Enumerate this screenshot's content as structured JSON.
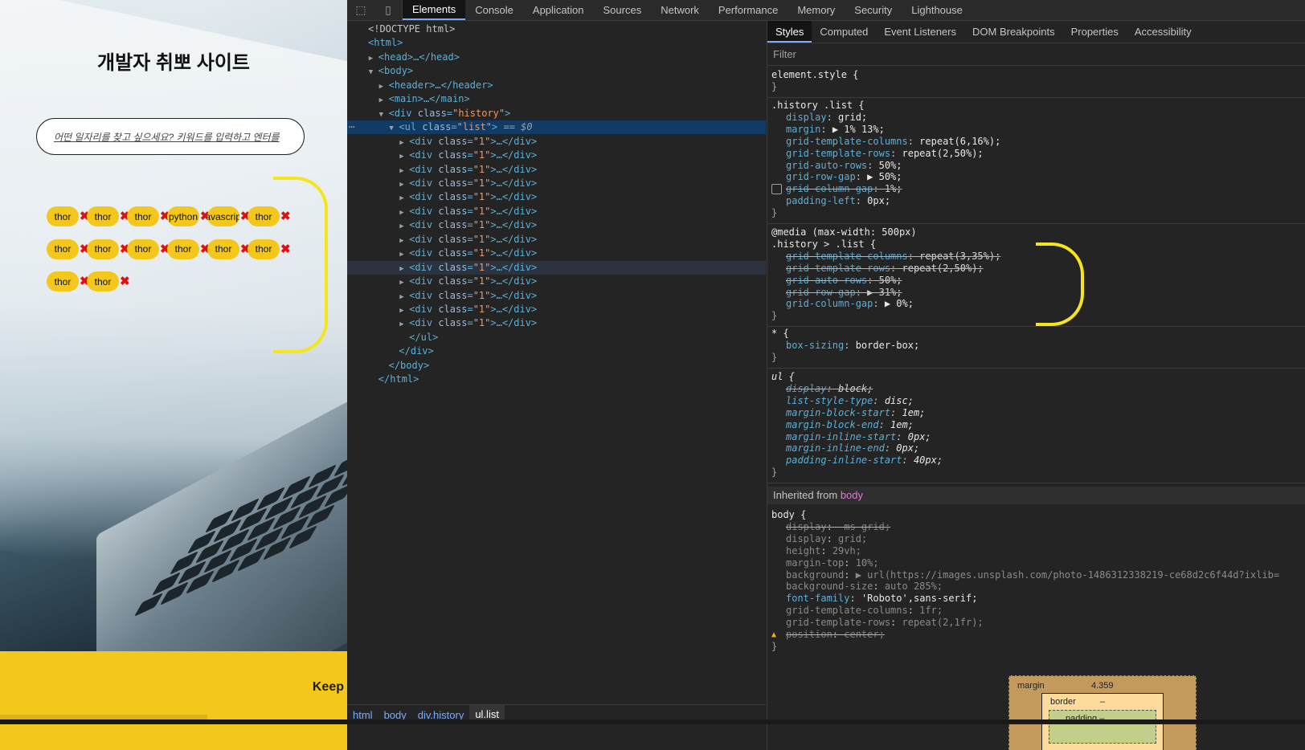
{
  "webpage": {
    "title": "개발자 취뽀 사이트",
    "search_placeholder": "어떤 일자리를 찾고 싶으세요? 키워드를 입력하고 엔터를",
    "tags": [
      "thor",
      "thor",
      "thor",
      "python",
      "javascript",
      "thor",
      "thor",
      "thor",
      "thor",
      "thor",
      "thor",
      "thor",
      "thor",
      "thor"
    ],
    "remove_glyph": "✖",
    "footer_text": "Keep"
  },
  "devtools": {
    "tabs": [
      "Elements",
      "Console",
      "Application",
      "Sources",
      "Network",
      "Performance",
      "Memory",
      "Security",
      "Lighthouse"
    ],
    "active_tab": "Elements",
    "dom": [
      {
        "indent": 0,
        "tri": "",
        "html": "&lt;!DOCTYPE html&gt;"
      },
      {
        "indent": 0,
        "tri": "",
        "tag": "<html>"
      },
      {
        "indent": 1,
        "tri": "▶",
        "tag": "<head>…</head>"
      },
      {
        "indent": 1,
        "tri": "▼",
        "tag": "<body>"
      },
      {
        "indent": 2,
        "tri": "▶",
        "tag": "<header>…</header>"
      },
      {
        "indent": 2,
        "tri": "▶",
        "tag": "<main>…</main>"
      },
      {
        "indent": 2,
        "tri": "▼",
        "tag": "<div",
        "attr": "class",
        "val": "\"history\"",
        "close": ">"
      },
      {
        "indent": 3,
        "tri": "▼",
        "tag": "<ul",
        "attr": "class",
        "val": "\"list\"",
        "close": ">",
        "suffix": " == $0",
        "selected": true
      },
      {
        "indent": 4,
        "tri": "▶",
        "tag": "<div",
        "attr": "class",
        "val": "\"1\"",
        "close": ">…</div>"
      },
      {
        "indent": 4,
        "tri": "▶",
        "tag": "<div",
        "attr": "class",
        "val": "\"1\"",
        "close": ">…</div>"
      },
      {
        "indent": 4,
        "tri": "▶",
        "tag": "<div",
        "attr": "class",
        "val": "\"1\"",
        "close": ">…</div>"
      },
      {
        "indent": 4,
        "tri": "▶",
        "tag": "<div",
        "attr": "class",
        "val": "\"1\"",
        "close": ">…</div>"
      },
      {
        "indent": 4,
        "tri": "▶",
        "tag": "<div",
        "attr": "class",
        "val": "\"1\"",
        "close": ">…</div>"
      },
      {
        "indent": 4,
        "tri": "▶",
        "tag": "<div",
        "attr": "class",
        "val": "\"1\"",
        "close": ">…</div>"
      },
      {
        "indent": 4,
        "tri": "▶",
        "tag": "<div",
        "attr": "class",
        "val": "\"1\"",
        "close": ">…</div>"
      },
      {
        "indent": 4,
        "tri": "▶",
        "tag": "<div",
        "attr": "class",
        "val": "\"1\"",
        "close": ">…</div>"
      },
      {
        "indent": 4,
        "tri": "▶",
        "tag": "<div",
        "attr": "class",
        "val": "\"1\"",
        "close": ">…</div>"
      },
      {
        "indent": 4,
        "tri": "▶",
        "tag": "<div",
        "attr": "class",
        "val": "\"1\"",
        "close": ">…</div>",
        "hover": true
      },
      {
        "indent": 4,
        "tri": "▶",
        "tag": "<div",
        "attr": "class",
        "val": "\"1\"",
        "close": ">…</div>"
      },
      {
        "indent": 4,
        "tri": "▶",
        "tag": "<div",
        "attr": "class",
        "val": "\"1\"",
        "close": ">…</div>"
      },
      {
        "indent": 4,
        "tri": "▶",
        "tag": "<div",
        "attr": "class",
        "val": "\"1\"",
        "close": ">…</div>"
      },
      {
        "indent": 4,
        "tri": "▶",
        "tag": "<div",
        "attr": "class",
        "val": "\"1\"",
        "close": ">…</div>"
      },
      {
        "indent": 4,
        "tri": "",
        "tag": "</ul>"
      },
      {
        "indent": 3,
        "tri": "",
        "tag": "</div>"
      },
      {
        "indent": 2,
        "tri": "",
        "tag": "</body>"
      },
      {
        "indent": 1,
        "tri": "",
        "tag": "</html>"
      }
    ],
    "breadcrumbs": [
      "html",
      "body",
      "div.history",
      "ul.list"
    ],
    "styles_tabs": [
      "Styles",
      "Computed",
      "Event Listeners",
      "DOM Breakpoints",
      "Properties",
      "Accessibility"
    ],
    "filter_placeholder": "Filter",
    "rules": [
      {
        "lines": [
          {
            "t": "sel",
            "text": "element.style {"
          },
          {
            "t": "close",
            "text": "}"
          }
        ]
      },
      {
        "lines": [
          {
            "t": "sel",
            "text": ".history .list {"
          },
          {
            "t": "p",
            "n": "display",
            "v": "grid;"
          },
          {
            "t": "p",
            "n": "margin",
            "v": "▶ 1% 13%;"
          },
          {
            "t": "p",
            "n": "grid-template-columns",
            "v": "repeat(6,16%);"
          },
          {
            "t": "p",
            "n": "grid-template-rows",
            "v": "repeat(2,50%);"
          },
          {
            "t": "p",
            "n": "grid-auto-rows",
            "v": "50%;"
          },
          {
            "t": "p",
            "n": "grid-row-gap",
            "v": "▶ 50%;"
          },
          {
            "t": "p",
            "n": "grid-column-gap",
            "v": "1%;",
            "struck": true,
            "checkbox": true
          },
          {
            "t": "p",
            "n": "padding-left",
            "v": "0px;"
          },
          {
            "t": "close",
            "text": "}"
          }
        ]
      },
      {
        "lines": [
          {
            "t": "sel",
            "text": "@media (max-width: 500px)"
          },
          {
            "t": "sel",
            "text": ".history > .list {"
          },
          {
            "t": "p",
            "n": "grid-template-columns",
            "v": "repeat(3,35%);",
            "struck": true
          },
          {
            "t": "p",
            "n": "grid-template-rows",
            "v": "repeat(2,50%);",
            "struck": true
          },
          {
            "t": "p",
            "n": "grid-auto-rows",
            "v": "50%;",
            "struck": true
          },
          {
            "t": "p",
            "n": "grid-row-gap",
            "v": "▶ 31%;",
            "struck": true
          },
          {
            "t": "p",
            "n": "grid-column-gap",
            "v": "▶ 0%;"
          },
          {
            "t": "close",
            "text": "}"
          }
        ]
      },
      {
        "lines": [
          {
            "t": "sel",
            "text": "* {"
          },
          {
            "t": "p",
            "n": "box-sizing",
            "v": "border-box;"
          },
          {
            "t": "close",
            "text": "}"
          }
        ]
      },
      {
        "lines": [
          {
            "t": "sel",
            "text": "ul {",
            "ital": true
          },
          {
            "t": "p",
            "n": "display",
            "v": "block;",
            "struck": true,
            "ital": true
          },
          {
            "t": "p",
            "n": "list-style-type",
            "v": "disc;",
            "ital": true
          },
          {
            "t": "p",
            "n": "margin-block-start",
            "v": "1em;",
            "ital": true
          },
          {
            "t": "p",
            "n": "margin-block-end",
            "v": "1em;",
            "ital": true
          },
          {
            "t": "p",
            "n": "margin-inline-start",
            "v": "0px;",
            "ital": true
          },
          {
            "t": "p",
            "n": "margin-inline-end",
            "v": "0px;",
            "ital": true
          },
          {
            "t": "p",
            "n": "padding-inline-start",
            "v": "40px;",
            "ital": true
          },
          {
            "t": "close",
            "text": "}"
          }
        ]
      }
    ],
    "inherited_label": "Inherited from",
    "inherited_from": "body",
    "body_rule": [
      {
        "t": "sel",
        "text": "body {"
      },
      {
        "t": "p",
        "n": "-ms-display",
        "v": "-ms-grid;",
        "struck": true,
        "dim": true,
        "raw": "display: -ms-grid;"
      },
      {
        "t": "p",
        "n": "display",
        "v": "grid;",
        "dim": true
      },
      {
        "t": "p",
        "n": "height",
        "v": "29vh;",
        "dim": true
      },
      {
        "t": "p",
        "n": "margin-top",
        "v": "10%;",
        "dim": true
      },
      {
        "t": "p",
        "n": "background",
        "v": "▶ url(https://images.unsplash.com/photo-1486312338219-ce68d2c6f44d?ixlib=",
        "dim": true
      },
      {
        "t": "p",
        "n": "background-size",
        "v": "auto 285%;",
        "dim": true
      },
      {
        "t": "p",
        "n": "font-family",
        "v": "'Roboto',sans-serif;"
      },
      {
        "t": "p",
        "n": "grid-template-columns",
        "v": "1fr;",
        "dim": true
      },
      {
        "t": "p",
        "n": "grid-template-rows",
        "v": "repeat(2,1fr);",
        "dim": true
      },
      {
        "t": "p",
        "n": "position",
        "v": "center;",
        "struck": true,
        "dim": true,
        "warn": true
      },
      {
        "t": "close",
        "text": "}"
      }
    ],
    "box_model": {
      "margin_label": "margin",
      "margin_value": "4.359",
      "border_label": "border",
      "border_value": "–",
      "padding_label": "padding –"
    }
  },
  "colors": {
    "accent_yellow": "#f3c71b",
    "selection_blue": "#113a64",
    "remove_red": "#dd1111"
  }
}
